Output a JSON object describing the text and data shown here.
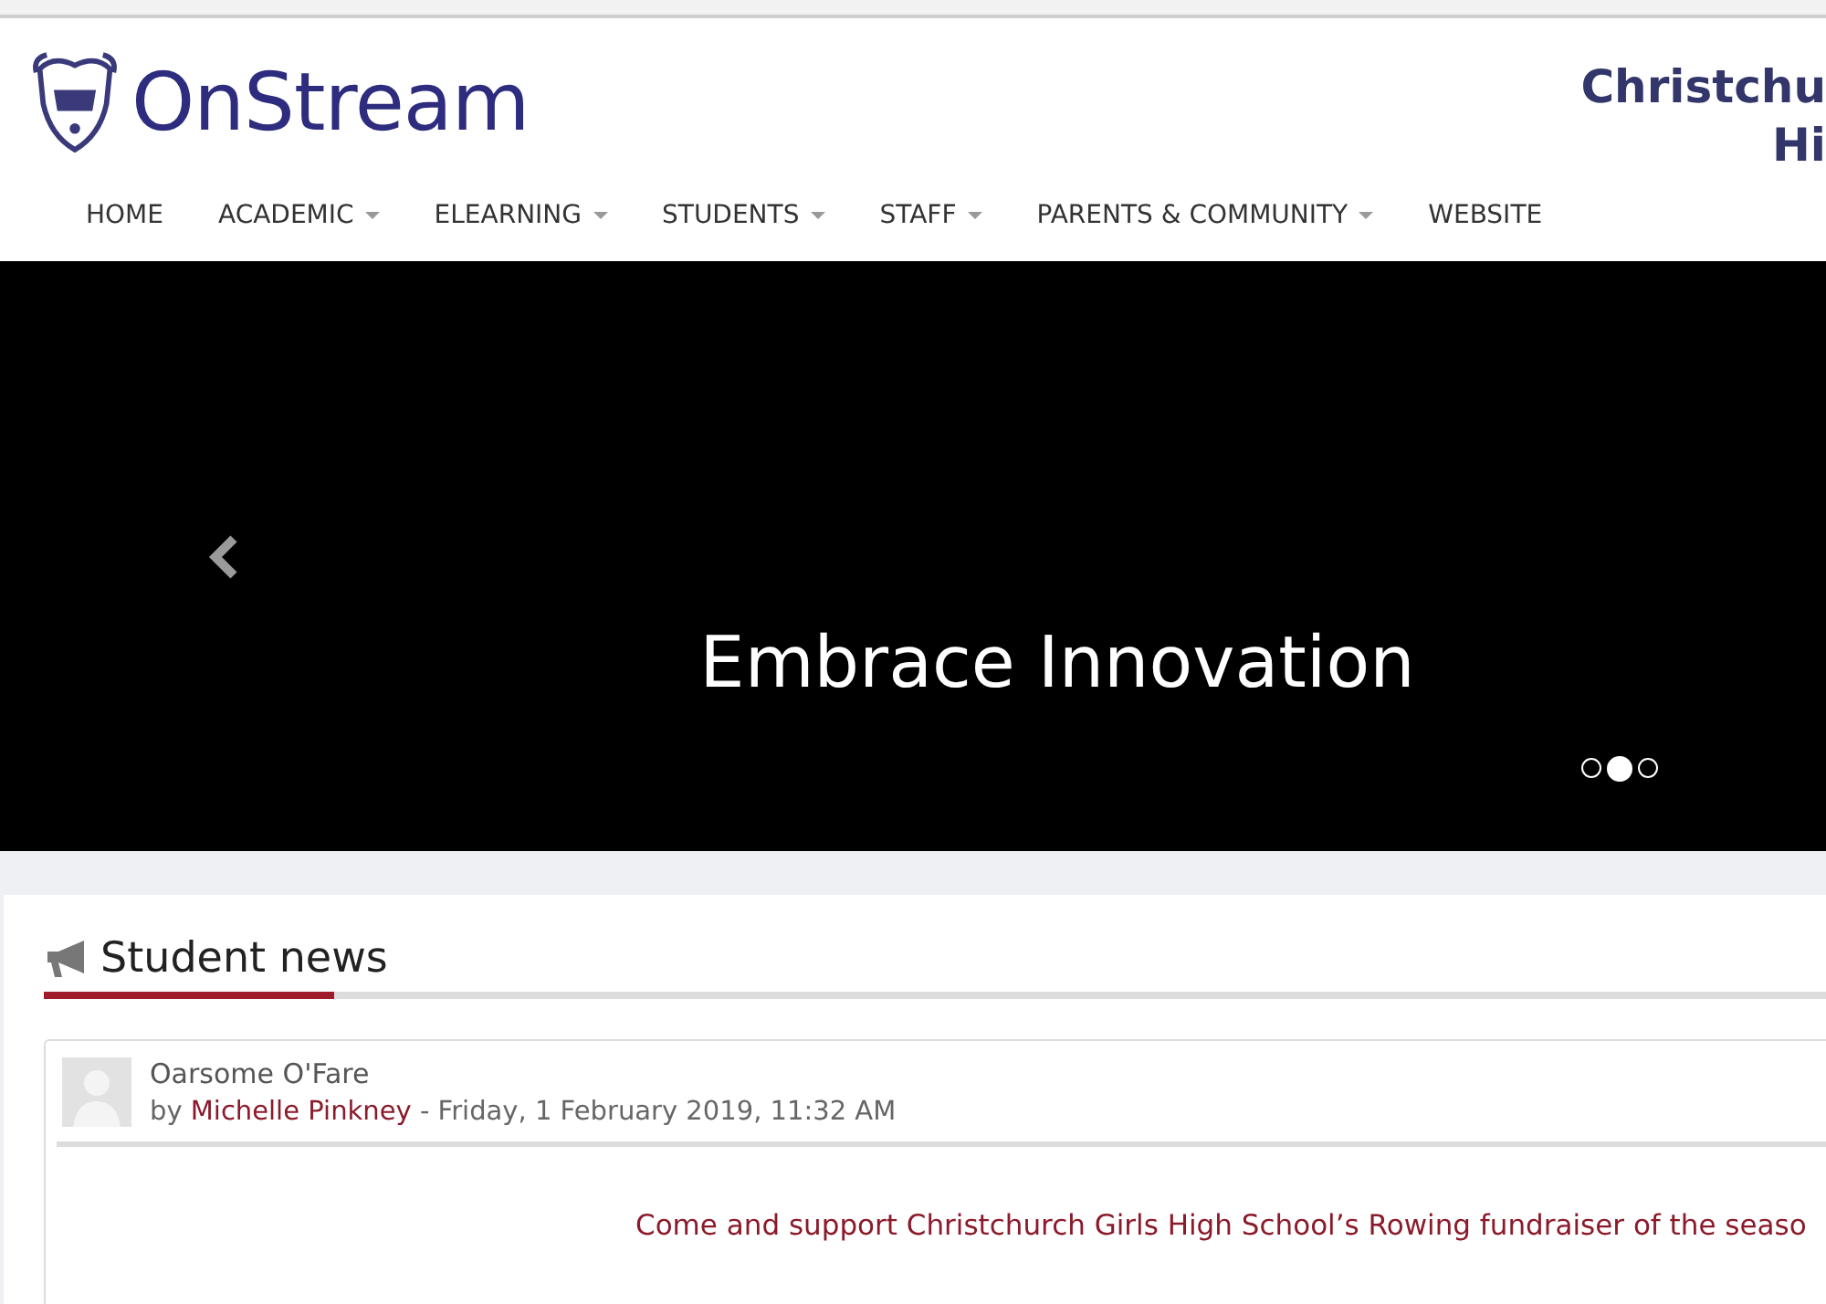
{
  "header": {
    "logo_text": "OnStream",
    "school_name_lines": [
      "Christchu",
      "Hi"
    ]
  },
  "nav": [
    {
      "label": "HOME",
      "dropdown": false
    },
    {
      "label": "ACADEMIC",
      "dropdown": true
    },
    {
      "label": "ELEARNING",
      "dropdown": true
    },
    {
      "label": "STUDENTS",
      "dropdown": true
    },
    {
      "label": "STAFF",
      "dropdown": true
    },
    {
      "label": "PARENTS & COMMUNITY",
      "dropdown": true
    },
    {
      "label": "WEBSITE",
      "dropdown": false
    }
  ],
  "carousel": {
    "caption": "Embrace Innovation",
    "indicators": [
      {
        "selected": false
      },
      {
        "selected": true
      },
      {
        "selected": false
      }
    ]
  },
  "news": {
    "title": "Student news",
    "post": {
      "subject": "Oarsome O'Fare",
      "by": "by",
      "author": "Michelle Pinkney",
      "date": "- Friday, 1 February 2019, 11:32 AM",
      "message": "Come and support Christchurch Girls High School’s Rowing fundraiser of the seaso"
    }
  }
}
